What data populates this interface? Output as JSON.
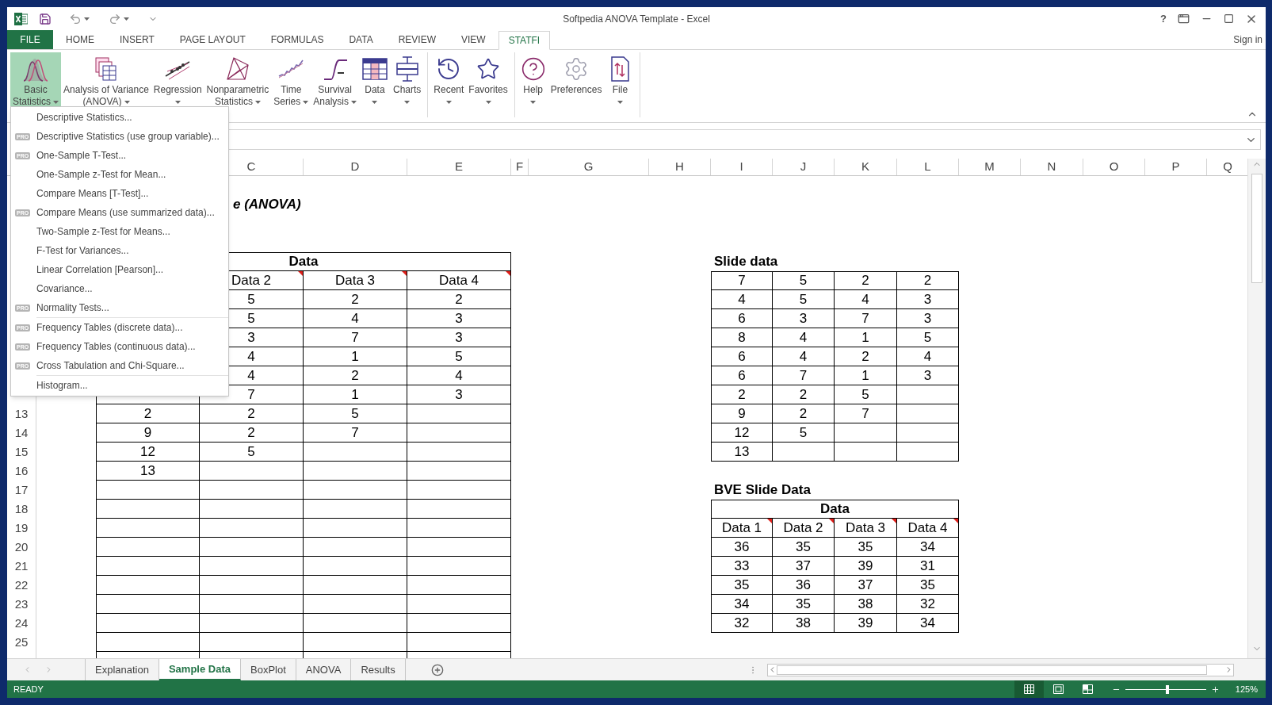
{
  "title_bar": {
    "title": "Softpedia ANOVA Template - Excel",
    "help": "?"
  },
  "ribbon_tabs": [
    {
      "label": "FILE",
      "kind": "file",
      "selected": false
    },
    {
      "label": "HOME",
      "kind": "tab",
      "selected": false
    },
    {
      "label": "INSERT",
      "kind": "tab",
      "selected": false
    },
    {
      "label": "PAGE LAYOUT",
      "kind": "tab",
      "selected": false
    },
    {
      "label": "FORMULAS",
      "kind": "tab",
      "selected": false
    },
    {
      "label": "DATA",
      "kind": "tab",
      "selected": false
    },
    {
      "label": "REVIEW",
      "kind": "tab",
      "selected": false
    },
    {
      "label": "VIEW",
      "kind": "tab",
      "selected": false
    },
    {
      "label": "STATFI",
      "kind": "tab",
      "selected": true
    }
  ],
  "sign_in": "Sign in",
  "ribbon": {
    "groups": [
      [
        {
          "kind": "bell-curve",
          "lines": [
            "Basic",
            "Statistics"
          ],
          "dropdown": true,
          "pressed": true
        },
        {
          "kind": "sheets",
          "lines": [
            "Analysis of Variance",
            "(ANOVA)"
          ],
          "dropdown": true,
          "pressed": false
        },
        {
          "kind": "regression",
          "lines": [
            "Regression"
          ],
          "dropdown": true,
          "pressed": false
        },
        {
          "kind": "polygon",
          "lines": [
            "Nonparametric",
            "Statistics"
          ],
          "dropdown": true,
          "pressed": false
        },
        {
          "kind": "series",
          "lines": [
            "Time",
            "Series"
          ],
          "dropdown": true,
          "pressed": false
        },
        {
          "kind": "survival",
          "lines": [
            "Survival",
            "Analysis"
          ],
          "dropdown": true,
          "pressed": false
        },
        {
          "kind": "table",
          "lines": [
            "Data"
          ],
          "dropdown": true,
          "pressed": false
        },
        {
          "kind": "boxplot",
          "lines": [
            "Charts"
          ],
          "dropdown": true,
          "pressed": false
        }
      ],
      [
        {
          "kind": "clock",
          "lines": [
            "Recent"
          ],
          "dropdown": true,
          "pressed": false
        },
        {
          "kind": "star",
          "lines": [
            "Favorites"
          ],
          "dropdown": true,
          "pressed": false
        }
      ],
      [
        {
          "kind": "help",
          "lines": [
            "Help"
          ],
          "dropdown": true,
          "pressed": false
        },
        {
          "kind": "gear",
          "lines": [
            "Preferences"
          ],
          "dropdown": false,
          "pressed": false
        },
        {
          "kind": "file",
          "lines": [
            "File"
          ],
          "dropdown": true,
          "pressed": false
        }
      ]
    ]
  },
  "menu": {
    "groups": [
      [
        {
          "label": "Descriptive Statistics..."
        },
        {
          "label": "Descriptive Statistics (use group variable)...",
          "badge": "PRO"
        },
        {
          "label": "One-Sample T-Test...",
          "badge": "PRO"
        },
        {
          "label": "One-Sample z-Test for Mean..."
        },
        {
          "label": "Compare Means [T-Test]..."
        },
        {
          "label": "Compare Means (use summarized data)...",
          "badge": "PRO"
        },
        {
          "label": "Two-Sample z-Test for Means..."
        },
        {
          "label": "F-Test for Variances..."
        },
        {
          "label": "Linear Correlation [Pearson]..."
        },
        {
          "label": "Covariance..."
        },
        {
          "label": "Normality Tests...",
          "badge": "PRO"
        }
      ],
      [
        {
          "label": "Frequency Tables (discrete data)...",
          "badge": "PRO"
        },
        {
          "label": "Frequency Tables (continuous data)...",
          "badge": "PRO"
        },
        {
          "label": "Cross Tabulation and Chi-Square...",
          "badge": "PRO"
        }
      ],
      [
        {
          "label": "Histogram..."
        }
      ]
    ]
  },
  "sheet": {
    "columns": [
      "C",
      "D",
      "E",
      "F",
      "G",
      "H",
      "I",
      "J",
      "K",
      "L",
      "M",
      "N",
      "O",
      "P",
      "Q"
    ],
    "row_numbers": [
      "13",
      "14",
      "15",
      "16",
      "17",
      "18",
      "19",
      "20",
      "21",
      "22",
      "23",
      "24",
      "25"
    ],
    "main_table": {
      "title": "e (ANOVA)",
      "caption": "Data",
      "headers": {
        "C": {
          "label": "Data 2",
          "comment": true
        },
        "D": {
          "label": "Data 3",
          "comment": true
        },
        "E": {
          "label": "Data 4",
          "comment": true
        }
      },
      "rows": [
        {
          "C": "5",
          "D": "2",
          "E": "2"
        },
        {
          "C": "5",
          "D": "4",
          "E": "3"
        },
        {
          "C": "3",
          "D": "7",
          "E": "3"
        },
        {
          "C": "4",
          "D": "1",
          "E": "5"
        },
        {
          "C": "4",
          "D": "2",
          "E": "4"
        },
        {
          "C": "7",
          "D": "1",
          "E": "3"
        },
        {
          "B": "2",
          "C": "2",
          "D": "5"
        },
        {
          "B": "9",
          "C": "2",
          "D": "7"
        },
        {
          "B": "12",
          "C": "5"
        },
        {
          "B": "13"
        }
      ]
    },
    "slide_table": {
      "caption": "Slide data",
      "rows": [
        [
          "7",
          "5",
          "2",
          "2"
        ],
        [
          "4",
          "5",
          "4",
          "3"
        ],
        [
          "6",
          "3",
          "7",
          "3"
        ],
        [
          "8",
          "4",
          "1",
          "5"
        ],
        [
          "6",
          "4",
          "2",
          "4"
        ],
        [
          "6",
          "7",
          "1",
          "3"
        ],
        [
          "2",
          "2",
          "5"
        ],
        [
          "9",
          "2",
          "7"
        ],
        [
          "12",
          "5"
        ],
        [
          "13"
        ]
      ]
    },
    "bve_table": {
      "caption": "BVE Slide Data",
      "group": "Data",
      "headers": [
        {
          "label": "Data 1",
          "comment": true
        },
        {
          "label": "Data 2",
          "comment": true
        },
        {
          "label": "Data 3",
          "comment": true
        },
        {
          "label": "Data 4",
          "comment": true
        }
      ],
      "rows": [
        [
          "36",
          "35",
          "35",
          "34"
        ],
        [
          "33",
          "37",
          "39",
          "31"
        ],
        [
          "35",
          "36",
          "37",
          "35"
        ],
        [
          "34",
          "35",
          "38",
          "32"
        ],
        [
          "32",
          "38",
          "39",
          "34"
        ]
      ]
    }
  },
  "sheet_tabs": [
    {
      "label": "Explanation",
      "selected": false
    },
    {
      "label": "Sample Data",
      "selected": true
    },
    {
      "label": "BoxPlot",
      "selected": false
    },
    {
      "label": "ANOVA",
      "selected": false
    },
    {
      "label": "Results",
      "selected": false
    }
  ],
  "status_bar": {
    "state": "READY",
    "views": [
      {
        "kind": "normal",
        "selected": true
      },
      {
        "kind": "page-layout",
        "selected": false
      },
      {
        "kind": "page-break",
        "selected": false
      }
    ],
    "zoom": {
      "level": 0.52,
      "reading": "125%"
    }
  }
}
